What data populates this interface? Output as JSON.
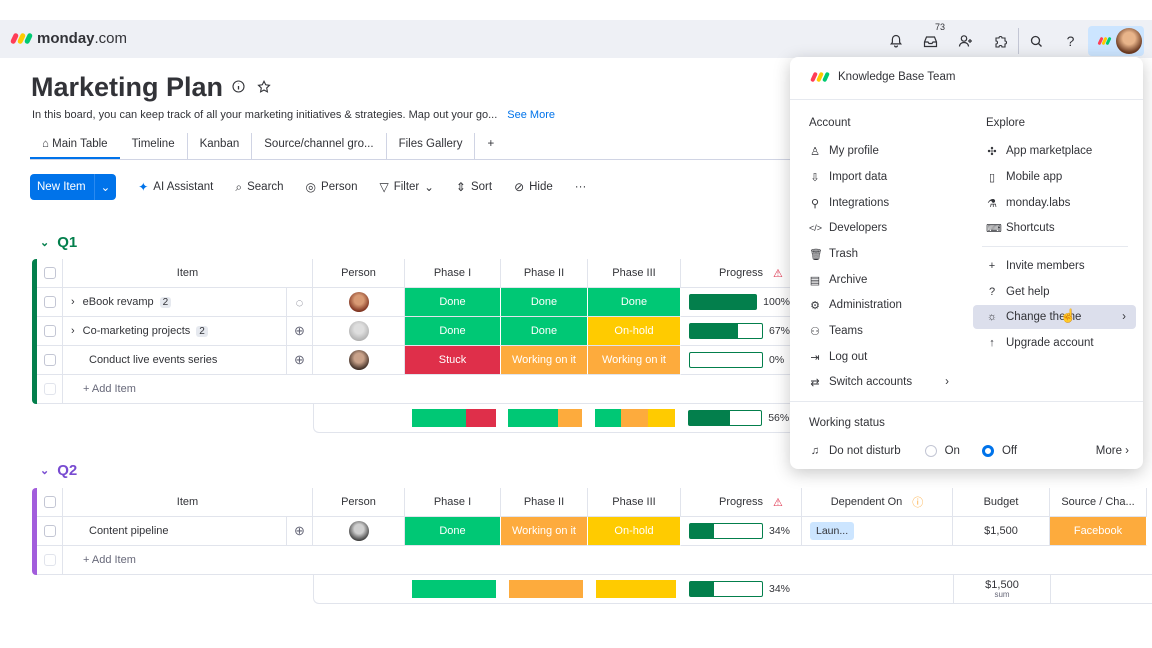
{
  "app": {
    "brand_bold": "monday",
    "brand_thin": ".com",
    "inbox_count": "73",
    "logo_colors": [
      "#ff3d57",
      "#ffcb00",
      "#00ca72"
    ]
  },
  "board": {
    "title": "Marketing Plan",
    "description": "In this board, you can keep track of all your marketing initiatives & strategies. Map out your go...",
    "see_more": "See More",
    "tabs": [
      "Main Table",
      "Timeline",
      "Kanban",
      "Source/channel gro...",
      "Files Gallery",
      "+"
    ],
    "toolbar": {
      "new_item": "New Item",
      "ai_assistant": "AI Assistant",
      "search": "Search",
      "person": "Person",
      "filter": "Filter",
      "sort": "Sort",
      "hide": "Hide",
      "more": "···"
    }
  },
  "groups": [
    {
      "name": "Q1",
      "color": "#037f4c",
      "columns": [
        "Item",
        "Person",
        "Phase I",
        "Phase II",
        "Phase III",
        "Progress"
      ],
      "rows": [
        {
          "item": "eBook revamp",
          "subitems": "2",
          "phase1": "Done",
          "phase2": "Done",
          "phase3": "Done",
          "progress": 100,
          "progress_label": "100%"
        },
        {
          "item": "Co-marketing projects",
          "subitems": "2",
          "phase1": "Done",
          "phase2": "Done",
          "phase3": "On-hold",
          "progress": 67,
          "progress_label": "67%"
        },
        {
          "item": "Conduct live events series",
          "subitems": "",
          "phase1": "Stuck",
          "phase2": "Working on it",
          "phase3": "Working on it",
          "progress": 0,
          "progress_label": "0%"
        }
      ],
      "add_item": "+ Add Item",
      "summary_progress": 56,
      "summary_progress_label": "56%"
    },
    {
      "name": "Q2",
      "color": "#784bd1",
      "columns": [
        "Item",
        "Person",
        "Phase I",
        "Phase II",
        "Phase III",
        "Progress",
        "Dependent On",
        "Budget",
        "Source / Cha..."
      ],
      "rows": [
        {
          "item": "Content pipeline",
          "phase1": "Done",
          "phase2": "Working on it",
          "phase3": "On-hold",
          "progress": 34,
          "progress_label": "34%",
          "dependent": "Laun...",
          "budget": "$1,500",
          "source": "Facebook"
        }
      ],
      "add_item": "+ Add Item",
      "summary_progress": 34,
      "summary_progress_label": "34%",
      "summary_budget": "$1,500",
      "summary_budget_sub": "sum"
    }
  ],
  "menu": {
    "team": "Knowledge Base Team",
    "account_title": "Account",
    "account_items": [
      "My profile",
      "Import data",
      "Integrations",
      "Developers",
      "Trash",
      "Archive",
      "Administration",
      "Teams",
      "Log out",
      "Switch accounts"
    ],
    "explore_title": "Explore",
    "explore_items": [
      "App marketplace",
      "Mobile app",
      "monday.labs",
      "Shortcuts"
    ],
    "other_items": [
      "Invite members",
      "Get help",
      "Change theme",
      "Upgrade account"
    ],
    "working_status_title": "Working status",
    "do_not_disturb": "Do not disturb",
    "on": "On",
    "off": "Off",
    "more": "More"
  }
}
